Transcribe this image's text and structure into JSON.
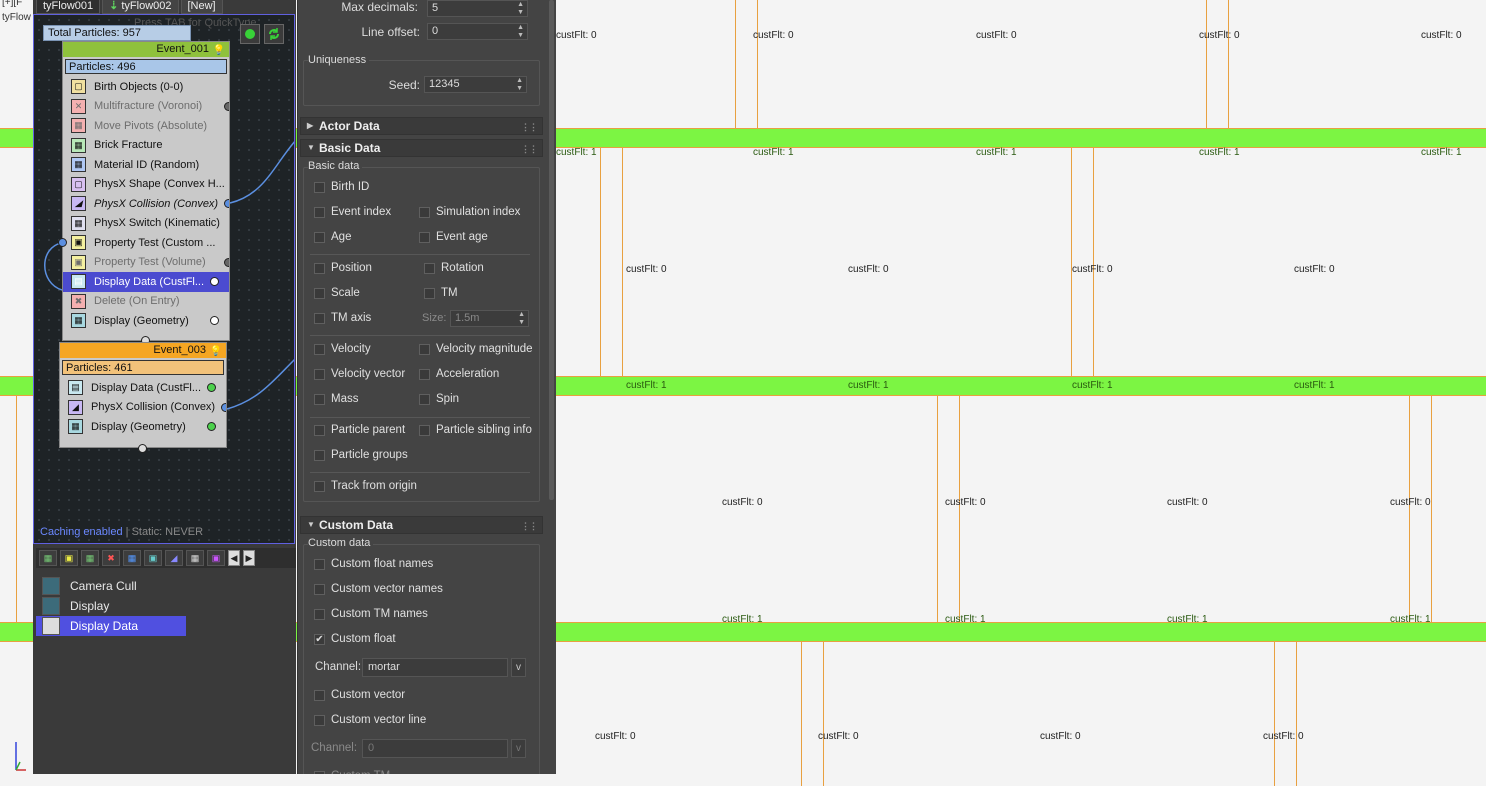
{
  "tabs": [
    {
      "label": "tyFlow001",
      "active": true
    },
    {
      "label": "tyFlow002",
      "active": false,
      "icon": "down-arrow-icon"
    },
    {
      "label": "[New]",
      "active": false
    }
  ],
  "viewport": {
    "corner_label_1": "[+][F",
    "corner_label_2": "tyFlow",
    "label_zero": "custFlt: 0",
    "label_one": "custFlt: 1",
    "colors": {
      "brick_band": "#7cf543",
      "mortar": "#e8a040",
      "background": "#f4f4f4"
    }
  },
  "graph": {
    "quicktype": "Press TAB for QuickType",
    "total_particles": "Total Particles: 957",
    "caching": "Caching enabled",
    "static": "Static: NEVER",
    "events": [
      {
        "title": "Event_001",
        "particles": "Particles: 496",
        "color": "#8fc13c",
        "operators": [
          {
            "label": "Birth Objects (0-0)",
            "icon": "birth-objects-icon",
            "state": "normal"
          },
          {
            "label": "Multifracture (Voronoi)",
            "icon": "multifracture-icon",
            "state": "disabled"
          },
          {
            "label": "Move Pivots (Absolute)",
            "icon": "move-pivots-icon",
            "state": "disabled"
          },
          {
            "label": "Brick Fracture",
            "icon": "brick-fracture-icon",
            "state": "normal"
          },
          {
            "label": "Material ID (Random)",
            "icon": "material-id-icon",
            "state": "normal"
          },
          {
            "label": "PhysX Shape (Convex H...",
            "icon": "physx-shape-icon",
            "state": "normal"
          },
          {
            "label": "PhysX Collision (Convex)",
            "icon": "physx-collision-icon",
            "state": "italic"
          },
          {
            "label": "PhysX Switch (Kinematic)",
            "icon": "physx-switch-icon",
            "state": "normal"
          },
          {
            "label": "Property Test (Custom ...",
            "icon": "property-test-icon",
            "state": "normal"
          },
          {
            "label": "Property Test (Volume)",
            "icon": "property-test-icon",
            "state": "disabled"
          },
          {
            "label": "Display Data (CustFl...",
            "icon": "display-data-icon",
            "state": "selected"
          },
          {
            "label": "Delete (On Entry)",
            "icon": "delete-icon",
            "state": "disabled"
          },
          {
            "label": "Display (Geometry)",
            "icon": "display-icon",
            "state": "normal"
          }
        ]
      },
      {
        "title": "Event_003",
        "particles": "Particles: 461",
        "color": "#f5a623",
        "operators": [
          {
            "label": "Display Data (CustFl...",
            "icon": "display-data-icon",
            "state": "normal"
          },
          {
            "label": "PhysX Collision (Convex)",
            "icon": "physx-collision-icon",
            "state": "normal"
          },
          {
            "label": "Display (Geometry)",
            "icon": "display-icon",
            "state": "normal"
          }
        ]
      }
    ]
  },
  "palette_list": [
    {
      "label": "Camera Cull",
      "icon": "camera-cull-icon"
    },
    {
      "label": "Display",
      "icon": "display-icon"
    },
    {
      "label": "Display Data",
      "icon": "display-data-icon",
      "selected": true
    }
  ],
  "panel": {
    "max_decimals_label": "Max decimals:",
    "max_decimals_value": "5",
    "line_offset_label": "Line offset:",
    "line_offset_value": "0",
    "uniqueness_title": "Uniqueness",
    "seed_label": "Seed:",
    "seed_value": "12345",
    "actor_data": "Actor Data",
    "basic_data": "Basic Data",
    "basic_data_group": "Basic data",
    "checkboxes": {
      "birth_id": "Birth ID",
      "event_index": "Event index",
      "simulation_index": "Simulation index",
      "age": "Age",
      "event_age": "Event age",
      "position": "Position",
      "rotation": "Rotation",
      "scale": "Scale",
      "tm": "TM",
      "tm_axis": "TM axis",
      "velocity": "Velocity",
      "velocity_magnitude": "Velocity magnitude",
      "velocity_vector": "Velocity vector",
      "acceleration": "Acceleration",
      "mass": "Mass",
      "spin": "Spin",
      "particle_parent": "Particle parent",
      "particle_sibling_info": "Particle sibling info",
      "particle_groups": "Particle groups",
      "track_from_origin": "Track from origin"
    },
    "size_label": "Size:",
    "size_value": "1.5m",
    "custom_data": "Custom Data",
    "custom_data_group": "Custom data",
    "custom": {
      "float_names": "Custom float names",
      "vector_names": "Custom vector names",
      "tm_names": "Custom TM names",
      "float": "Custom float",
      "vector": "Custom vector",
      "vector_line": "Custom vector line",
      "tm_partial": "Custom TM"
    },
    "channel_label": "Channel:",
    "channel_value": "mortar",
    "channel2_value": "0",
    "v_button": "v"
  }
}
